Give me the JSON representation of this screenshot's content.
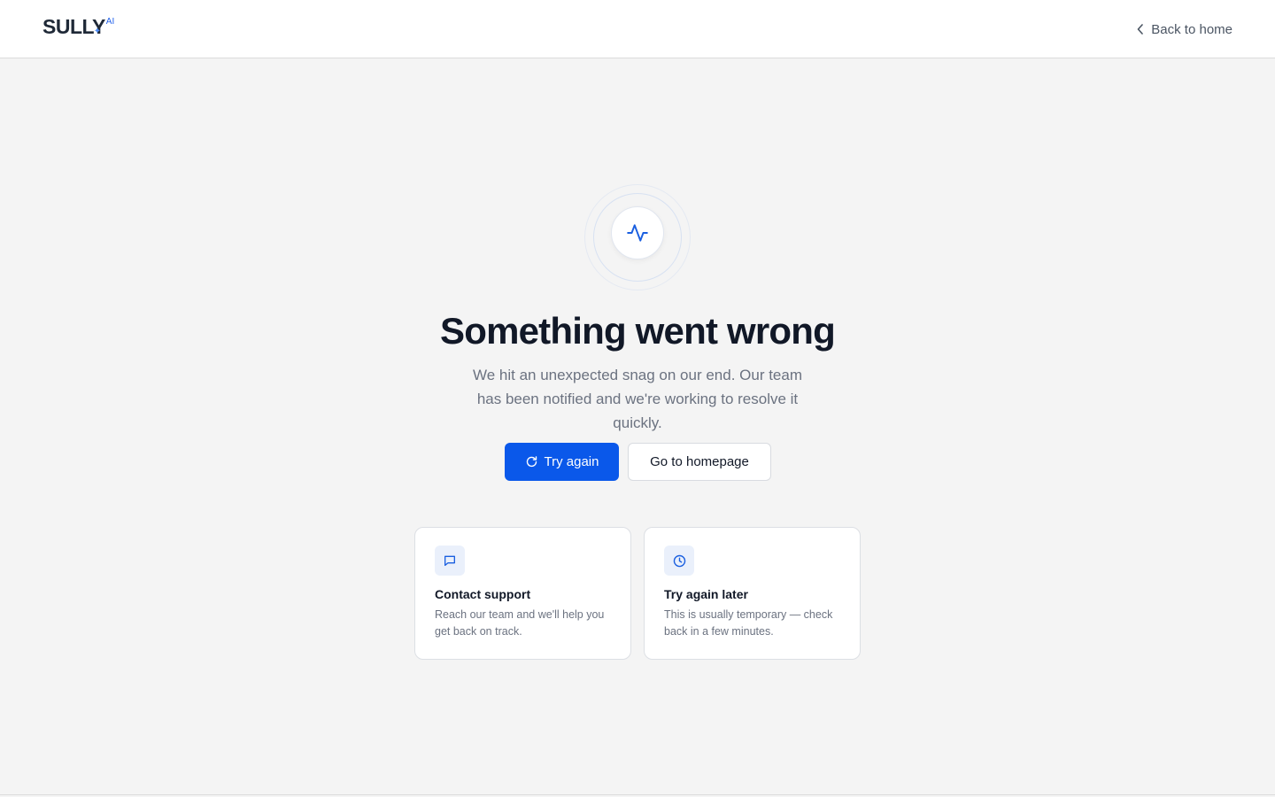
{
  "header": {
    "logo_text": "SULLY",
    "logo_sup": "AI",
    "back_label": "Back to home"
  },
  "hero": {
    "icon": "activity-icon",
    "title": "Something went wrong",
    "subtitle": "We hit an unexpected snag on our end. Our team has been notified and we're working to resolve it quickly."
  },
  "actions": {
    "primary_label": "Try again",
    "primary_icon": "refresh-icon",
    "secondary_label": "Go to homepage"
  },
  "cards": [
    {
      "icon": "message-square-icon",
      "title": "Contact support",
      "description": "Reach our team and we'll help you get back on track."
    },
    {
      "icon": "clock-icon",
      "title": "Try again later",
      "description": "This is usually temporary — check back in a few minutes."
    }
  ],
  "colors": {
    "accent": "#0a58ea",
    "background": "#f4f4f4",
    "icon_tint": "#eaf0fb"
  }
}
